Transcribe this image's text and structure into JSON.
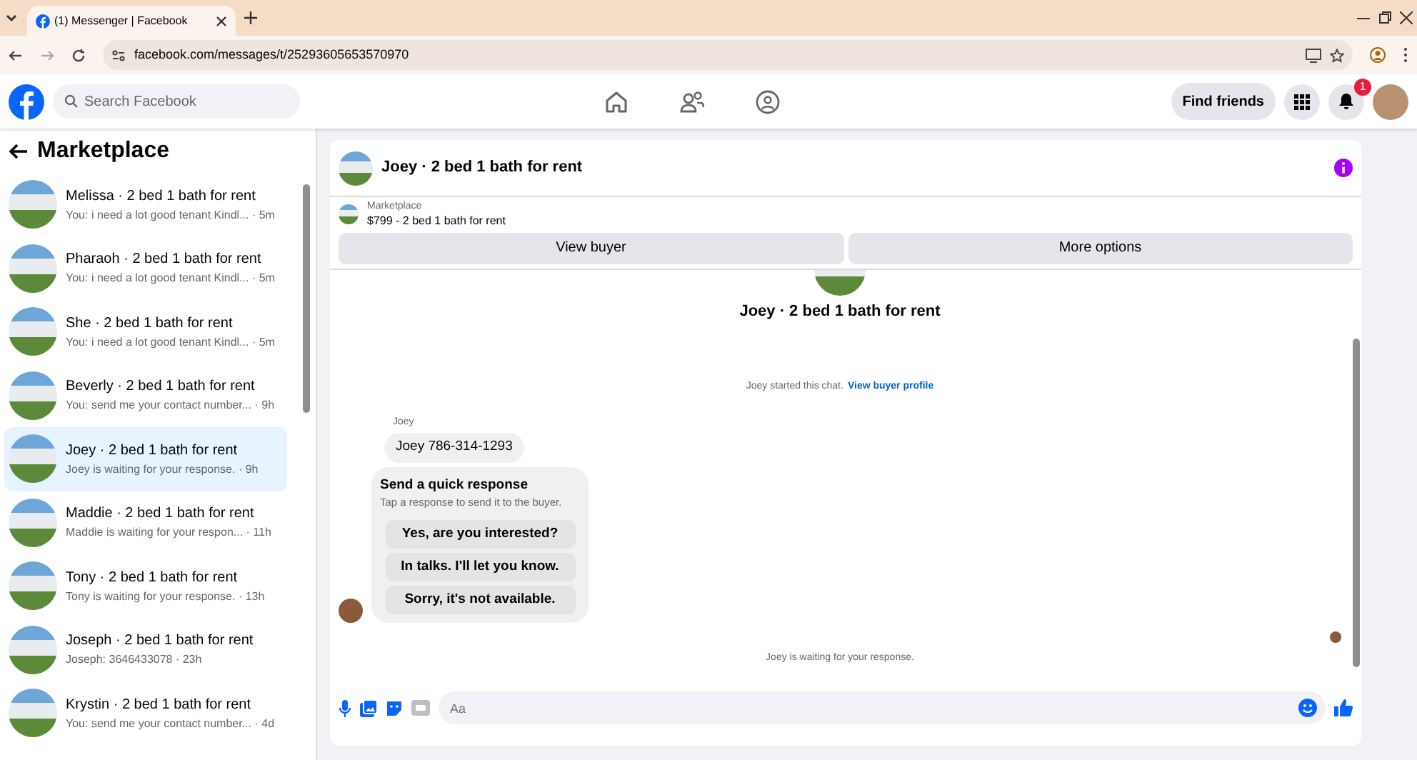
{
  "browser": {
    "tab_title": "(1) Messenger | Facebook",
    "url": "facebook.com/messages/t/25293605653570970"
  },
  "header": {
    "search_placeholder": "Search Facebook",
    "find_friends": "Find friends",
    "notification_count": "1"
  },
  "sidebar": {
    "title": "Marketplace",
    "conversations": [
      {
        "name": "Melissa · 2 bed 1 bath for rent",
        "preview": "You: i need a lot good tenant Kindl... · 5m",
        "selected": false
      },
      {
        "name": "Pharaoh · 2 bed 1 bath for rent",
        "preview": "You: i need a lot good tenant Kindl... · 5m",
        "selected": false
      },
      {
        "name": "She · 2 bed 1 bath for rent",
        "preview": "You: i need a lot good tenant Kindl... · 5m",
        "selected": false
      },
      {
        "name": "Beverly · 2 bed 1 bath for rent",
        "preview": "You: send me your contact number... · 9h",
        "selected": false
      },
      {
        "name": "Joey · 2 bed 1 bath for rent",
        "preview": "Joey is waiting for your response. · 9h",
        "selected": true
      },
      {
        "name": "Maddie · 2 bed 1 bath for rent",
        "preview": "Maddie is waiting for your respon... · 11h",
        "selected": false
      },
      {
        "name": "Tony · 2 bed 1 bath for rent",
        "preview": "Tony is waiting for your response. · 13h",
        "selected": false
      },
      {
        "name": "Joseph · 2 bed 1 bath for rent",
        "preview": "Joseph: 3646433078 · 23h",
        "selected": false
      },
      {
        "name": "Krystin · 2 bed 1 bath for rent",
        "preview": "You: send me your contact number... · 4d",
        "selected": false
      }
    ]
  },
  "chat": {
    "title": "Joey · 2 bed 1 bath for rent",
    "listing": {
      "label": "Marketplace",
      "title": "$799 - 2 bed 1 bath for rent"
    },
    "buttons": [
      "View buyer",
      "More options"
    ],
    "profile_title": "Joey · 2 bed 1 bath for rent",
    "system_note": {
      "text": "Joey started this chat.",
      "link": "View buyer profile"
    },
    "sender": "Joey",
    "message": "Joey 786-314-1293",
    "quick_response": {
      "title": "Send a quick response",
      "subtitle": "Tap a response to send it to the buyer.",
      "options": [
        "Yes, are you interested?",
        "In talks. I'll let you know.",
        "Sorry, it's not available."
      ]
    },
    "status": "Joey is waiting for your response.",
    "composer_placeholder": "Aa"
  }
}
